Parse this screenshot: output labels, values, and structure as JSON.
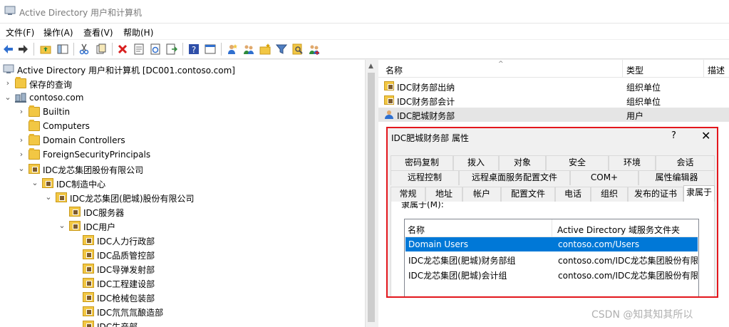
{
  "window": {
    "title": "Active Directory 用户和计算机"
  },
  "menu": {
    "items": [
      "文件(F)",
      "操作(A)",
      "查看(V)",
      "帮助(H)"
    ]
  },
  "toolbar": {
    "icons": [
      "back-arrow-icon",
      "forward-arrow-icon",
      "up-folder-icon",
      "show-hide-tree-icon",
      "cut-icon",
      "copy-icon",
      "delete-icon",
      "properties-icon",
      "refresh-icon",
      "export-list-icon",
      "help-icon",
      "console-tree-icon",
      "new-user-icon",
      "new-group-icon",
      "new-ou-icon",
      "filter-icon",
      "find-icon",
      "add-to-group-icon"
    ]
  },
  "tree": {
    "root": "Active Directory 用户和计算机 [DC001.contoso.com]",
    "items": [
      {
        "label": "保存的查询",
        "level": 1,
        "expander": "›"
      },
      {
        "label": "contoso.com",
        "level": 1,
        "expander": "⌄"
      },
      {
        "label": "Builtin",
        "level": 2,
        "expander": "›"
      },
      {
        "label": "Computers",
        "level": 2,
        "expander": ""
      },
      {
        "label": "Domain Controllers",
        "level": 2,
        "expander": "›"
      },
      {
        "label": "ForeignSecurityPrincipals",
        "level": 2,
        "expander": "›"
      },
      {
        "label": "IDC龙芯集团股份有限公司",
        "level": 2,
        "expander": "⌄"
      },
      {
        "label": "IDC制造中心",
        "level": 3,
        "expander": "⌄"
      },
      {
        "label": "IDC龙芯集团(肥城)股份有限公司",
        "level": 4,
        "expander": "⌄"
      },
      {
        "label": "IDC服务器",
        "level": 5,
        "expander": ""
      },
      {
        "label": "IDC用户",
        "level": 5,
        "expander": "⌄"
      },
      {
        "label": "IDC人力行政部",
        "level": 6,
        "expander": ""
      },
      {
        "label": "IDC品质管控部",
        "level": 6,
        "expander": ""
      },
      {
        "label": "IDC导弹发射部",
        "level": 6,
        "expander": ""
      },
      {
        "label": "IDC工程建设部",
        "level": 6,
        "expander": ""
      },
      {
        "label": "IDC枪械包装部",
        "level": 6,
        "expander": ""
      },
      {
        "label": "IDC氘氘氚酿造部",
        "level": 6,
        "expander": ""
      },
      {
        "label": "IDC生产部",
        "level": 6,
        "expander": ""
      }
    ]
  },
  "list": {
    "headers": {
      "name": "名称",
      "type": "类型",
      "desc": "描述"
    },
    "rows": [
      {
        "name": "IDC财务部出纳",
        "type": "组织单位",
        "kind": "ou"
      },
      {
        "name": "IDC财务部会计",
        "type": "组织单位",
        "kind": "ou"
      },
      {
        "name": "IDC肥城财务部",
        "type": "用户",
        "kind": "user"
      }
    ]
  },
  "dialog": {
    "title": "IDC肥城财务部 属性",
    "help": "?",
    "close": "✕",
    "tabs_row1": [
      "密码复制",
      "拨入",
      "对象",
      "安全",
      "环境",
      "会话"
    ],
    "tabs_row2": [
      "远程控制",
      "远程桌面服务配置文件",
      "COM+",
      "属性编辑器"
    ],
    "tabs_row3": [
      "常规",
      "地址",
      "帐户",
      "配置文件",
      "电话",
      "组织",
      "发布的证书",
      "隶属于"
    ],
    "active_tab": "隶属于",
    "memberof_label": "隶属于(M):",
    "grid_headers": {
      "name": "名称",
      "folder": "Active Directory 域服务文件夹"
    },
    "grid_rows": [
      {
        "name": "Domain Users",
        "folder": "contoso.com/Users",
        "selected": true
      },
      {
        "name": "IDC龙芯集团(肥城)财务部组",
        "folder": "contoso.com/IDC龙芯集团股份有限",
        "selected": false
      },
      {
        "name": "IDC龙芯集团(肥城)会计组",
        "folder": "contoso.com/IDC龙芯集团股份有限",
        "selected": false
      }
    ]
  },
  "watermark": "CSDN @知其知其所以",
  "colors": {
    "selection": "#0078d7",
    "highlight_border": "#e3161c",
    "folder": "#f2c744"
  }
}
